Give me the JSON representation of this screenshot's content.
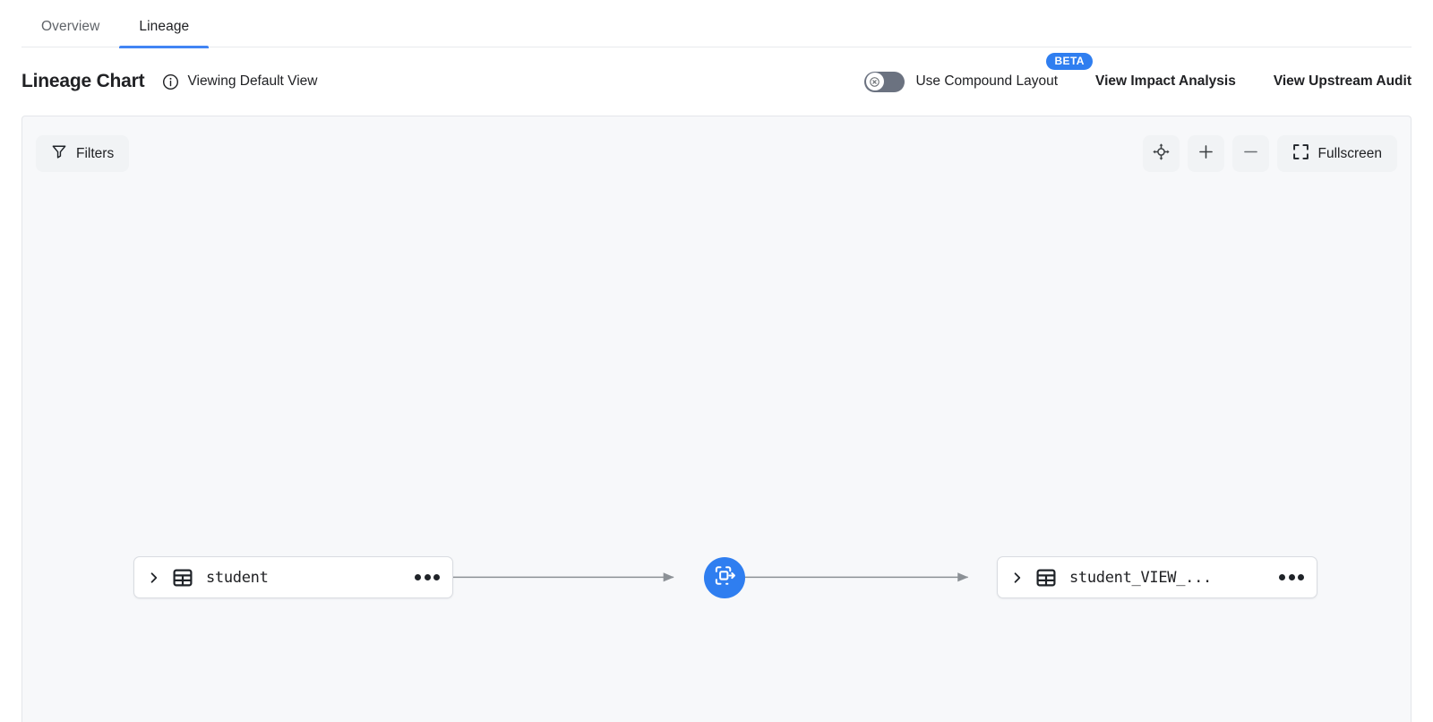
{
  "tabs": [
    {
      "label": "Overview",
      "active": false
    },
    {
      "label": "Lineage",
      "active": true
    }
  ],
  "header": {
    "title": "Lineage Chart",
    "info_icon": "info-circle-icon",
    "viewing_label": "Viewing Default View",
    "toggle": {
      "label": "Use Compound Layout",
      "state": "off",
      "knob_icon": "close-x-icon",
      "badge": "BETA"
    },
    "links": [
      {
        "label": "View Impact Analysis"
      },
      {
        "label": "View Upstream Audit"
      }
    ]
  },
  "canvas_toolbar": {
    "filters": {
      "label": "Filters",
      "icon": "funnel-icon"
    },
    "recenter": {
      "icon": "crosshair-recenter-icon"
    },
    "zoom_in": {
      "icon": "plus-icon",
      "label": "+"
    },
    "zoom_out": {
      "icon": "minus-icon",
      "label": "−"
    },
    "fullscreen": {
      "label": "Fullscreen",
      "icon": "fullscreen-icon"
    }
  },
  "graph": {
    "nodes": [
      {
        "id": "student",
        "label": "student",
        "type": "table",
        "expand_icon": "chevron-right-icon",
        "entity_icon": "table-grid-icon",
        "menu_icon": "more-options-icon"
      },
      {
        "id": "transform",
        "label": "",
        "type": "transformation",
        "entity_icon": "transform-arrow-icon",
        "color": "#2f7ef0"
      },
      {
        "id": "student_view",
        "label": "student_VIEW_...",
        "type": "table",
        "expand_icon": "chevron-right-icon",
        "entity_icon": "table-grid-icon",
        "menu_icon": "more-options-icon"
      }
    ],
    "edges": [
      {
        "from": "student",
        "to": "transform"
      },
      {
        "from": "transform",
        "to": "student_view"
      }
    ]
  },
  "colors": {
    "accent": "#4285f4",
    "badge": "#2f7ef0",
    "canvas_bg": "#f7f8fa",
    "edge": "#8c9196"
  }
}
